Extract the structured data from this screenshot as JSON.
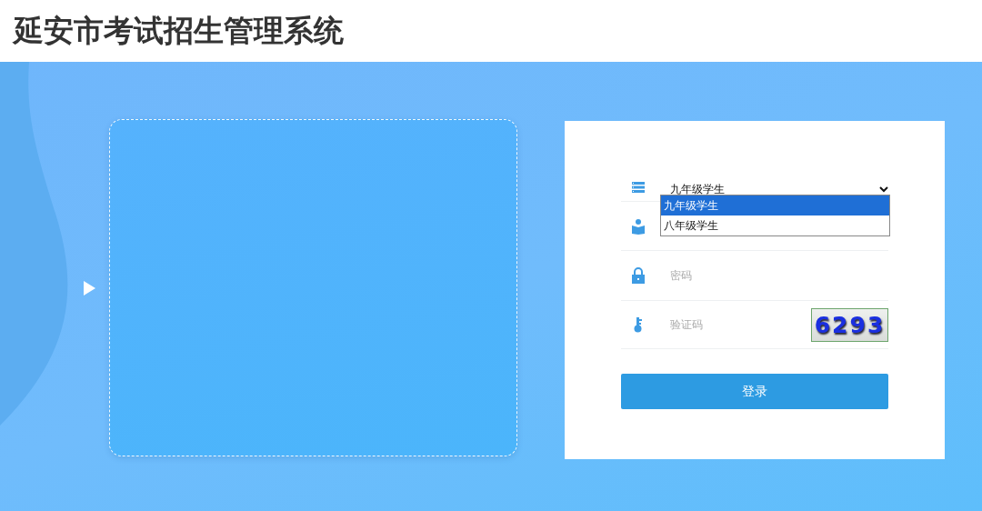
{
  "header": {
    "title": "延安市考试招生管理系统"
  },
  "login_form": {
    "student_type": {
      "value": "九年级学生",
      "expanded": true,
      "options": [
        {
          "label": "九年级学生",
          "selected": true
        },
        {
          "label": "八年级学生",
          "selected": false
        }
      ]
    },
    "fields": [
      {
        "kind": "user"
      },
      {
        "kind": "password",
        "placeholder": "密码"
      },
      {
        "kind": "captcha",
        "placeholder": "验证码",
        "captcha": "6293"
      }
    ],
    "submit": "登录"
  }
}
